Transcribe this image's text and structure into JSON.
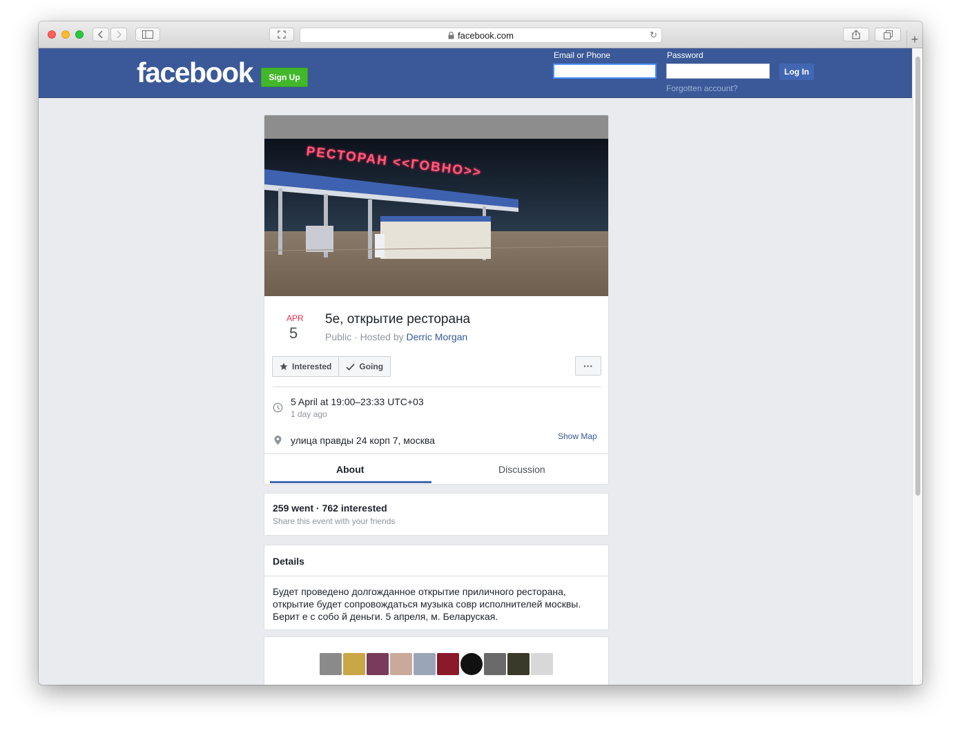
{
  "browser": {
    "url": "facebook.com"
  },
  "header": {
    "logo": "facebook",
    "signup_label": "Sign Up",
    "email_label": "Email or Phone",
    "email_value": "",
    "password_label": "Password",
    "password_value": "",
    "login_label": "Log In",
    "forgot_label": "Forgotten account?"
  },
  "event": {
    "cover_sign_text": "РЕСТОРАН <<ГОВНО>>",
    "month": "APR",
    "day": "5",
    "title": "5е, открытие ресторана",
    "privacy": "Public · Hosted by",
    "host": "Derric Morgan",
    "interested_label": "Interested",
    "going_label": "Going",
    "more_label": "···",
    "time": "5 April at 19:00–23:33 UTC+03",
    "time_ago": "1 day ago",
    "location": "улица правды 24 корп 7, москва",
    "show_map_label": "Show Map",
    "tabs": [
      {
        "label": "About",
        "active": true
      },
      {
        "label": "Discussion",
        "active": false
      }
    ]
  },
  "stats": {
    "summary": "259 went · 762 interested",
    "share": "Share this event with your friends"
  },
  "details": {
    "title": "Details",
    "body": "Будет проведено долгожданное открытие приличного ресторана, открытие будет сопровождаться музыка совр исполнителей москвы. Берит е с собо й деньги. 5 апреля, м. Беларуская."
  },
  "colors": {
    "brand_blue": "#3b5998",
    "signup_green": "#42b72a",
    "date_red": "#f02849",
    "link_blue": "#365899"
  }
}
